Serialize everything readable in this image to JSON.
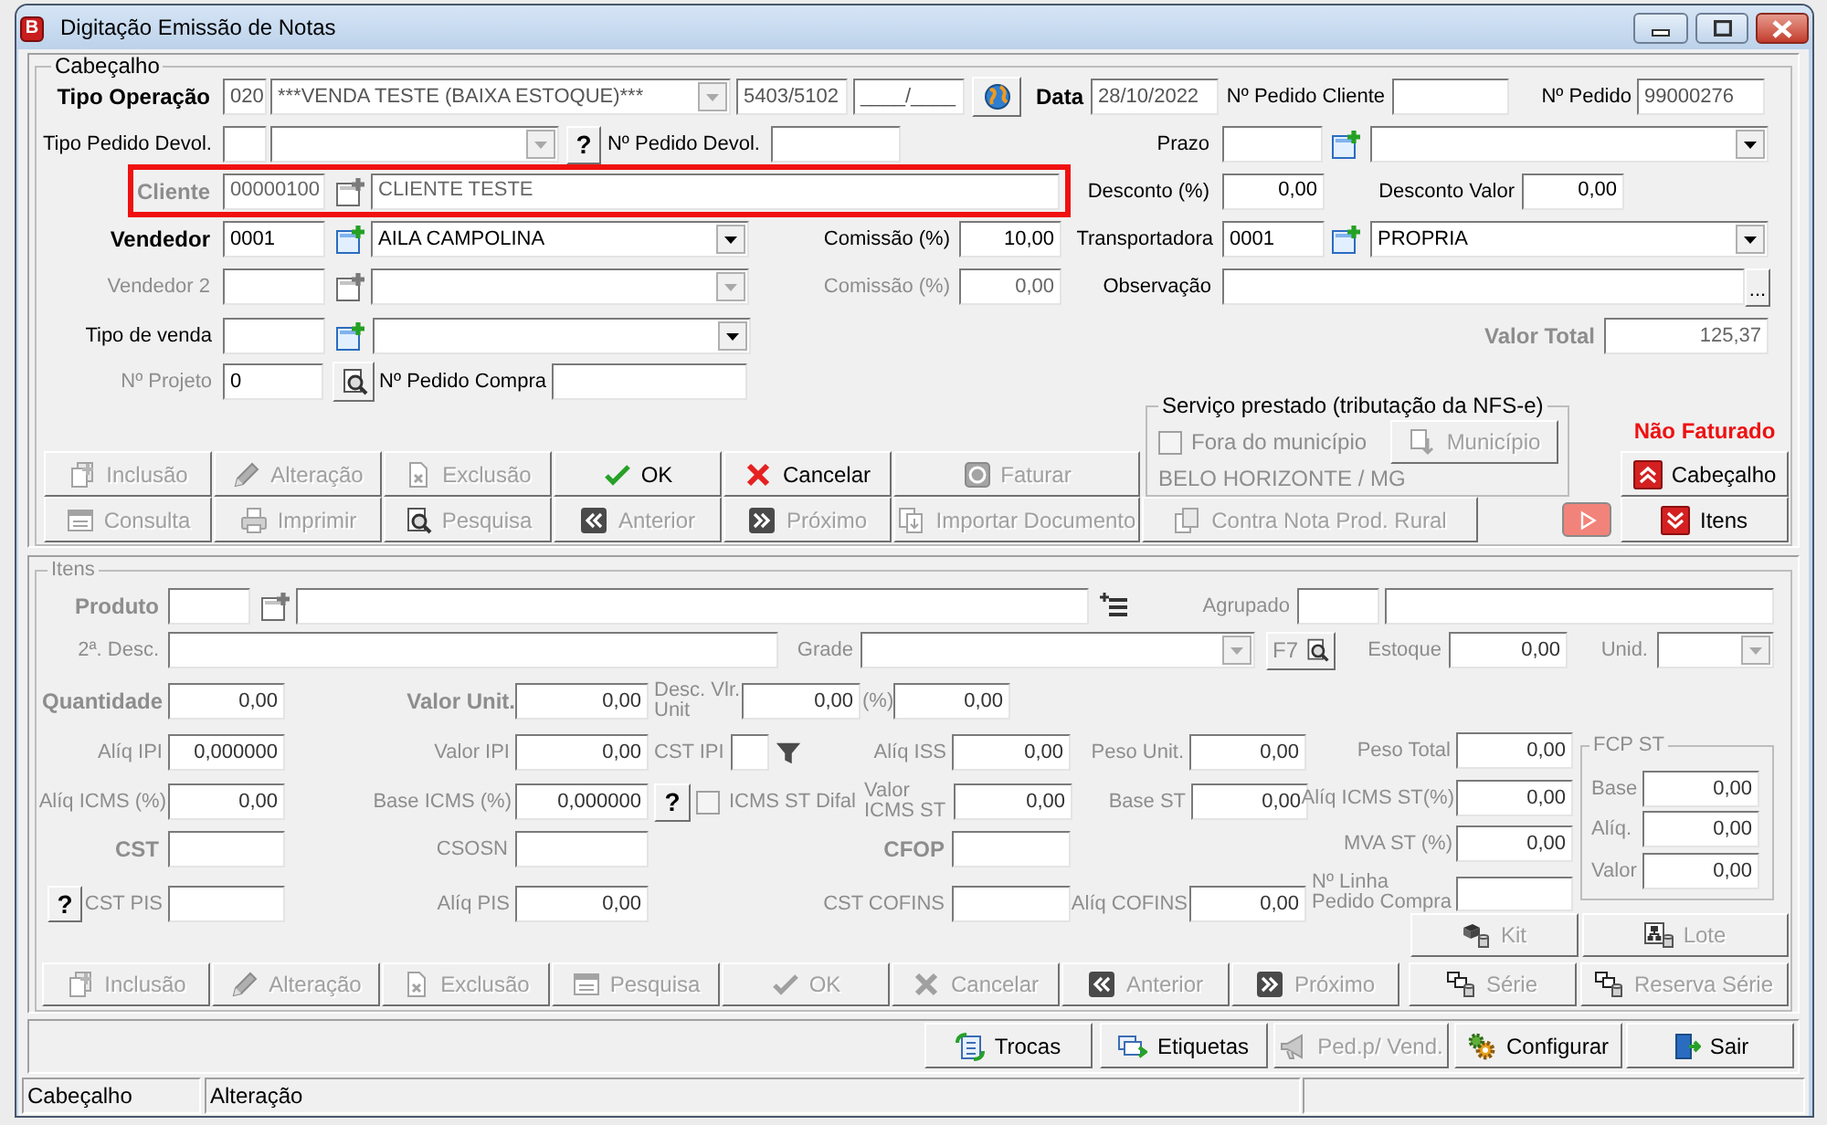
{
  "window": {
    "title": "Digitação Emissão de Notas",
    "icon_letter": "B"
  },
  "cabecalho": {
    "legend": "Cabeçalho",
    "tipo_operacao": {
      "label": "Tipo Operação",
      "code": "020",
      "description": "***VENDA TESTE (BAIXA ESTOQUE)***",
      "list_disabled": true,
      "cfop": "5403/5102",
      "cfop_2": "____/____"
    },
    "data": {
      "label": "Data",
      "value": "28/10/2022"
    },
    "pedido_cliente": {
      "label": "Nº Pedido Cliente"
    },
    "pedido": {
      "label": "Nº Pedido",
      "value": "99000276"
    },
    "tipo_pedido_devol": {
      "label": "Tipo Pedido Devol.",
      "list_disabled": true,
      "help_button": "?"
    },
    "pedido_devol": {
      "label": "Nº Pedido Devol."
    },
    "prazo": {
      "label": "Prazo",
      "list_disabled": false
    },
    "cliente": {
      "label": "Cliente",
      "code": "00000100",
      "name": "CLIENTE TESTE",
      "disabled": true,
      "highlighted": true
    },
    "desconto_percentual": {
      "label": "Desconto (%)",
      "value": "0,00"
    },
    "desconto_valor": {
      "label": "Desconto Valor",
      "value": "0,00"
    },
    "vendedor": {
      "label": "Vendedor",
      "code": "0001",
      "name": "AILA CAMPOLINA",
      "disabled": false
    },
    "comissao": {
      "label": "Comissão (%)",
      "value": "10,00",
      "disabled": false
    },
    "transportadora": {
      "label": "Transportadora",
      "code": "0001",
      "name": "PROPRIA"
    },
    "vendedor_2": {
      "label": "Vendedor 2",
      "disabled": true
    },
    "comissao_2": {
      "label": "Comissão (%)",
      "value": "0,00",
      "disabled": true
    },
    "observacao": {
      "label": "Observação",
      "button": "..."
    },
    "tipo_venda": {
      "label": "Tipo de venda"
    },
    "valor_total": {
      "label": "Valor Total",
      "value": "125,37",
      "disabled": true
    },
    "projeto": {
      "label": "Nº Projeto",
      "value": "0",
      "disabled": true
    },
    "pedido_compra": {
      "label": "Nº Pedido Compra"
    },
    "button_rows": [
      [
        {
          "label": "Inclusão",
          "disabled": true
        },
        {
          "label": "Alteração",
          "disabled": true
        },
        {
          "label": "Exclusão",
          "disabled": true
        },
        {
          "label": "OK",
          "disabled": false
        },
        {
          "label": "Cancelar",
          "disabled": false
        },
        {
          "label": "Faturar",
          "disabled": true
        }
      ],
      [
        {
          "label": "Consulta",
          "disabled": true
        },
        {
          "label": "Imprimir",
          "disabled": true
        },
        {
          "label": "Pesquisa",
          "disabled": true
        },
        {
          "label": "Anterior",
          "disabled": true
        },
        {
          "label": "Próximo",
          "disabled": true
        },
        {
          "label": "Importar Documento",
          "disabled": true
        },
        {
          "label": "Contra Nota Prod. Rural",
          "disabled": true
        }
      ]
    ],
    "servico_prestado": {
      "legend": "Serviço prestado (tributação da NFS-e)",
      "fora_do_municipio": {
        "label": "Fora do município",
        "checked": false,
        "disabled": true
      },
      "municipio_button": {
        "label": "Município",
        "disabled": true
      },
      "cidade": "BELO HORIZONTE / MG"
    },
    "status": "Não Faturado",
    "sections": [
      {
        "label": "Cabeçalho",
        "disabled": false
      },
      {
        "label": "Itens",
        "disabled": false
      }
    ]
  },
  "itens": {
    "legend": "Itens",
    "disabled": true,
    "produto": {
      "label": "Produto"
    },
    "agrupado": {
      "label": "Agrupado"
    },
    "segunda_descricao": {
      "label": "2ª. Desc."
    },
    "grade": {
      "label": "Grade"
    },
    "f7_button": {
      "label": "F7"
    },
    "estoque": {
      "label": "Estoque",
      "value": "0,00"
    },
    "unidade": {
      "label": "Unid."
    },
    "quantidade": {
      "label": "Quantidade",
      "value": "0,00"
    },
    "valor_unitario": {
      "label": "Valor Unit.",
      "value": "0,00"
    },
    "desconto_valor_unitario": {
      "label": "Desc. Vlr. Unit",
      "value": "0,00"
    },
    "desconto_percentual": {
      "label": "(%)",
      "value": "0,00"
    },
    "aliq_ipi": {
      "label": "Alíq IPI",
      "value": "0,000000"
    },
    "valor_ipi": {
      "label": "Valor IPI",
      "value": "0,00"
    },
    "cst_ipi": {
      "label": "CST IPI"
    },
    "aliq_iss": {
      "label": "Alíq ISS",
      "value": "0,00"
    },
    "peso_unitario": {
      "label": "Peso Unit.",
      "value": "0,00"
    },
    "peso_total": {
      "label": "Peso Total",
      "value": "0,00"
    },
    "aliq_icms": {
      "label": "Alíq ICMS (%)",
      "value": "0,00"
    },
    "base_icms": {
      "label": "Base ICMS (%)",
      "value": "0,000000",
      "help_button": "?"
    },
    "icms_st_difal": {
      "label": "ICMS ST Difal",
      "checked": false
    },
    "valor_icms_st": {
      "label": "Valor ICMS ST",
      "value": "0,00"
    },
    "base_st": {
      "label": "Base ST",
      "value": "0,00"
    },
    "aliq_icms_st": {
      "label": "Alíq ICMS ST(%)",
      "value": "0,00"
    },
    "cst": {
      "label": "CST"
    },
    "csosn": {
      "label": "CSOSN"
    },
    "cfop": {
      "label": "CFOP"
    },
    "mva_st": {
      "label": "MVA ST (%)",
      "value": "0,00"
    },
    "cst_pis": {
      "label": "CST PIS",
      "help_button": "?"
    },
    "aliq_pis": {
      "label": "Alíq PIS",
      "value": "0,00"
    },
    "cst_cofins": {
      "label": "CST COFINS"
    },
    "aliq_cofins": {
      "label": "Alíq COFINS",
      "value": "0,00"
    },
    "linha_pedido_compra": {
      "label": "Nº Linha Pedido Compra"
    },
    "fcp_st": {
      "legend": "FCP ST",
      "fields": [
        {
          "label": "Base",
          "value": "0,00"
        },
        {
          "label": "Alíq.",
          "value": "0,00"
        },
        {
          "label": "Valor",
          "value": "0,00"
        }
      ]
    },
    "extra_buttons": [
      {
        "label": "Kit",
        "disabled": true
      },
      {
        "label": "Lote",
        "disabled": true
      }
    ],
    "buttons": [
      {
        "label": "Inclusão",
        "disabled": true
      },
      {
        "label": "Alteração",
        "disabled": true
      },
      {
        "label": "Exclusão",
        "disabled": true
      },
      {
        "label": "Pesquisa",
        "disabled": true
      },
      {
        "label": "OK",
        "disabled": true
      },
      {
        "label": "Cancelar",
        "disabled": true
      },
      {
        "label": "Anterior",
        "disabled": true
      },
      {
        "label": "Próximo",
        "disabled": true
      },
      {
        "label": "Série",
        "disabled": true
      },
      {
        "label": "Reserva Série",
        "disabled": true
      }
    ]
  },
  "footer_buttons": [
    {
      "label": "Trocas",
      "disabled": false
    },
    {
      "label": "Etiquetas",
      "disabled": false
    },
    {
      "label": "Ped.p/ Vend.",
      "disabled": true
    },
    {
      "label": "Configurar",
      "disabled": false
    },
    {
      "label": "Sair",
      "disabled": false
    }
  ],
  "status_bar": {
    "panels": [
      "Cabeçalho",
      "Alteração"
    ]
  }
}
